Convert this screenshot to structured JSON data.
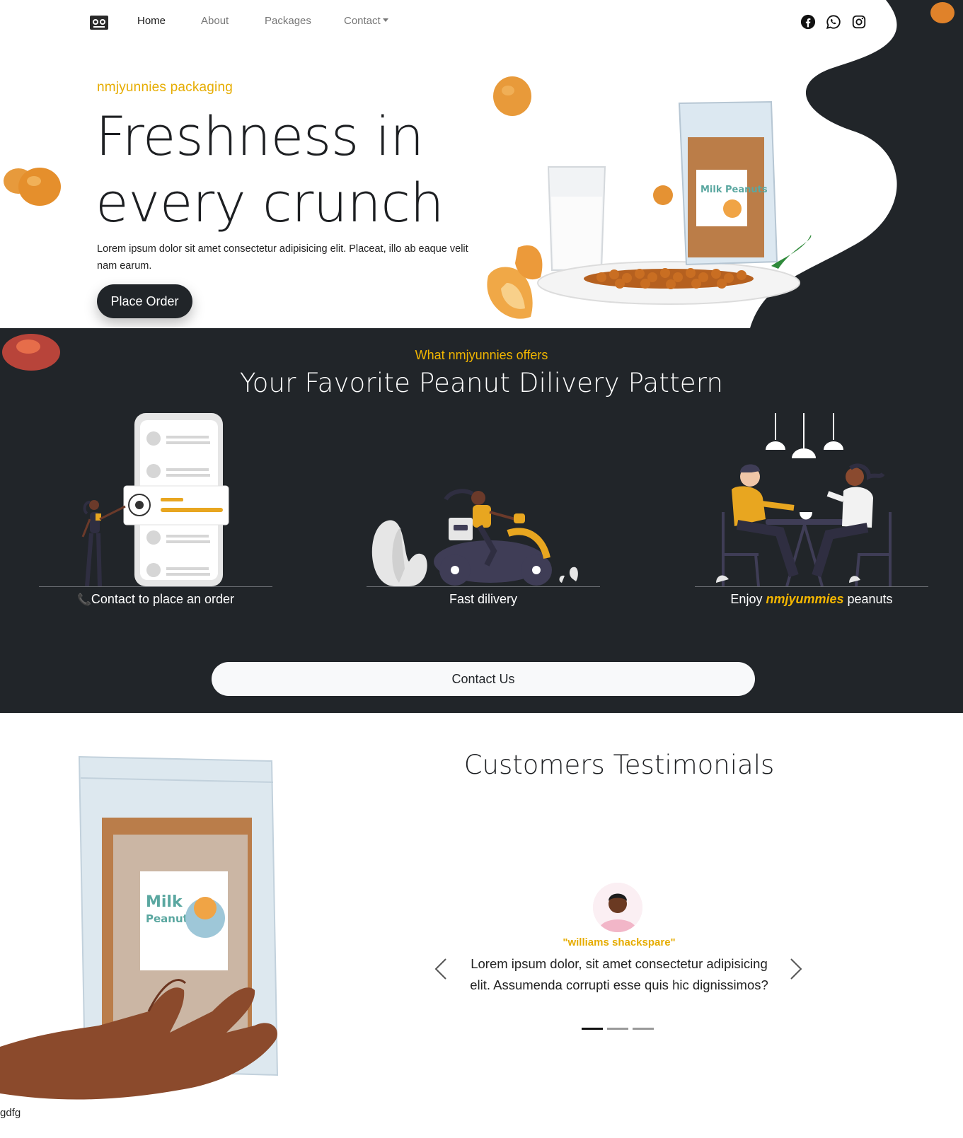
{
  "nav": {
    "links": [
      {
        "label": "Home",
        "active": true
      },
      {
        "label": "About",
        "active": false
      },
      {
        "label": "Packages",
        "active": false
      },
      {
        "label": "Contact",
        "active": false,
        "dropdown": true
      }
    ],
    "social_icons": [
      "facebook-icon",
      "whatsapp-icon",
      "instagram-icon"
    ]
  },
  "hero": {
    "eyebrow": "nmjyunnies packaging",
    "title_line1": "Freshness in",
    "title_line2": "every crunch",
    "text": "Lorem ipsum dolor sit amet consectetur adipisicing elit. Placeat, illo ab eaque velit nam earum.",
    "button": "Place Order",
    "package_label": "Milk Peanuts"
  },
  "offers": {
    "eyebrow": "What nmjyunnies offers",
    "title": "Your Favorite Peanut Dilivery Pattern",
    "steps": [
      {
        "icon": "phone-icon",
        "caption": "Contact to place an order"
      },
      {
        "caption": "Fast dilivery"
      },
      {
        "caption_before": "Enjoy ",
        "caption_em": "nmjyummies",
        "caption_after": " peanuts"
      }
    ],
    "button": "Contact Us"
  },
  "testimonials": {
    "title": "Customers Testimonials",
    "author": "\"williams shackspare\"",
    "quote": "Lorem ipsum dolor, sit amet consectetur adipisicing elit. Assumenda corrupti esse quis hic dignissimos?",
    "active_slide": 1,
    "slide_count": 3,
    "package_label_top": "Milk",
    "package_label_bottom": "Peanuts"
  },
  "footer": {
    "text": "gdfg"
  },
  "colors": {
    "dark": "#212529",
    "accent": "#f2b600",
    "light": "#f8f9fa"
  }
}
